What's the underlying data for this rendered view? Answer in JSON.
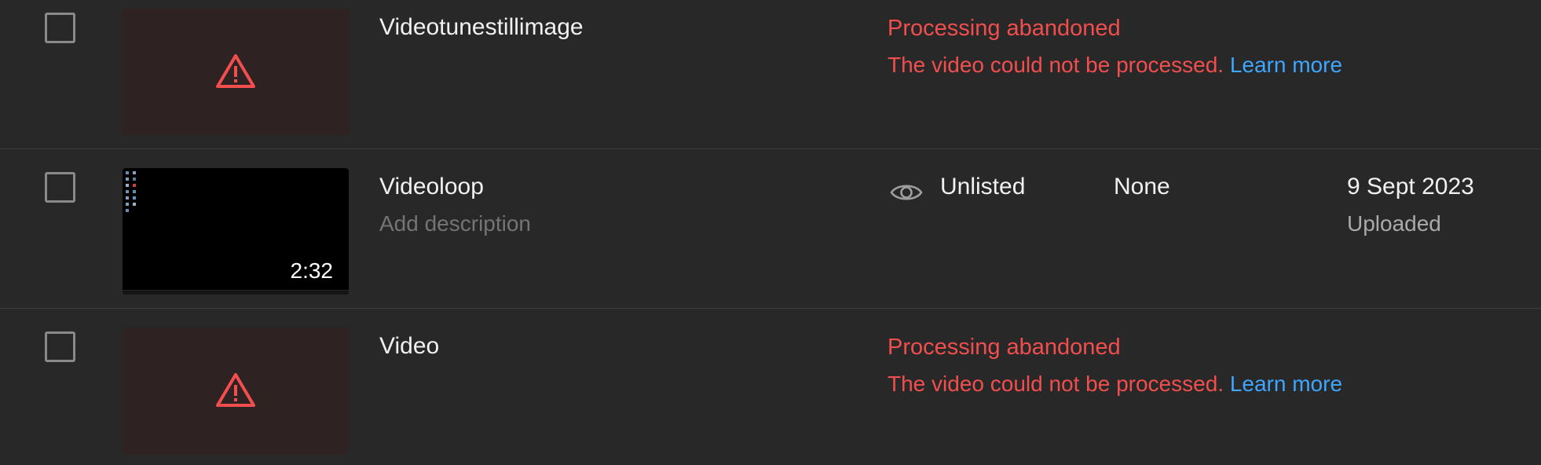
{
  "colors": {
    "background": "#282828",
    "error": "#f24e4e",
    "link": "#3ea6ff",
    "divider": "#3d3d3d"
  },
  "rows": [
    {
      "title": "Videotunestillimage",
      "status_title": "Processing abandoned",
      "status_message": "The video could not be processed.",
      "status_link": "Learn more",
      "thumbnail_icon": "warning-icon"
    },
    {
      "title": "Videoloop",
      "description_placeholder": "Add description",
      "duration": "2:32",
      "visibility_icon": "eye-icon",
      "visibility": "Unlisted",
      "restrictions": "None",
      "date": "9 Sept 2023",
      "date_status": "Uploaded"
    },
    {
      "title": "Video",
      "status_title": "Processing abandoned",
      "status_message": "The video could not be processed.",
      "status_link": "Learn more",
      "thumbnail_icon": "warning-icon"
    }
  ]
}
